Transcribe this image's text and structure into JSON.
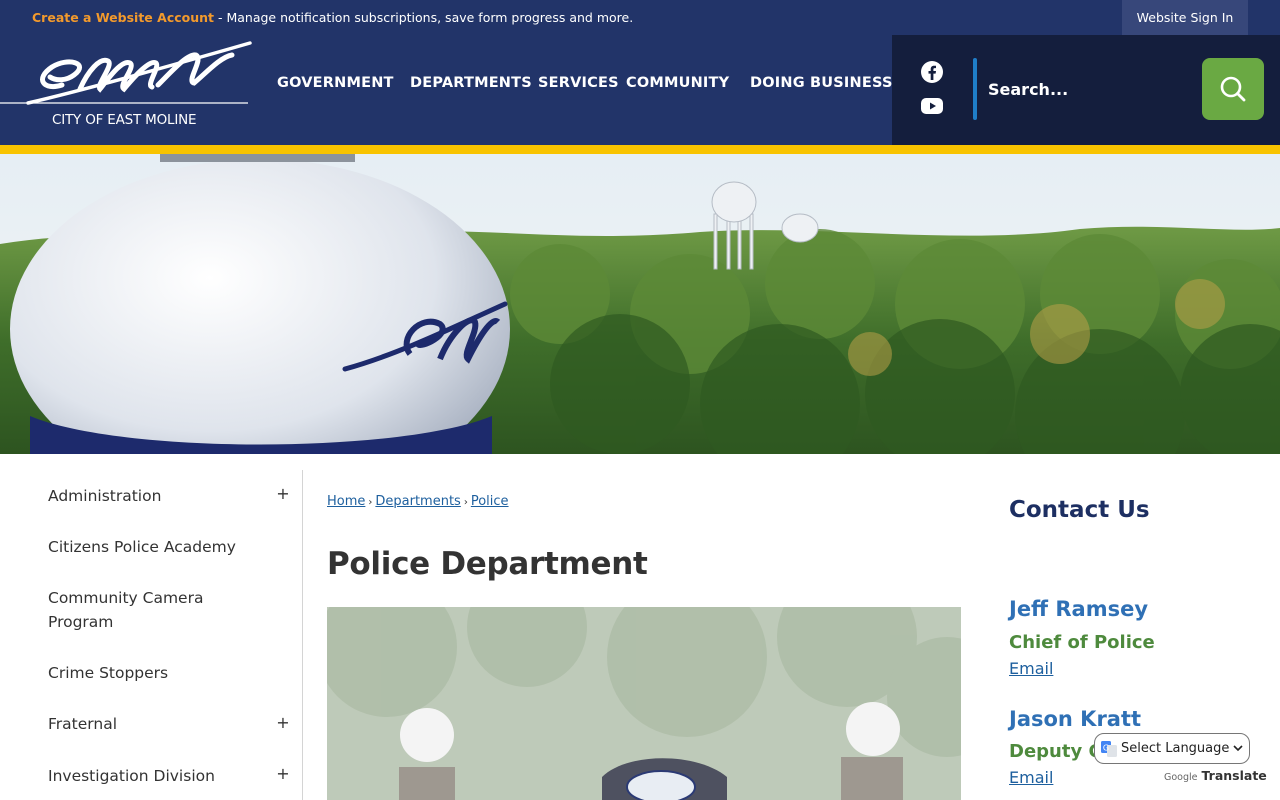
{
  "topbar": {
    "create_link": "Create a Website Account",
    "message": " - Manage notification subscriptions, save form progress and more.",
    "signin": "Website Sign In"
  },
  "logo": {
    "text": "CITY OF EAST MOLINE"
  },
  "nav": {
    "items": [
      {
        "label": "GOVERNMENT"
      },
      {
        "label": "DEPARTMENTS"
      },
      {
        "label": "SERVICES"
      },
      {
        "label": "COMMUNITY"
      },
      {
        "label": "DOING BUSINESS"
      }
    ]
  },
  "social": {
    "icons": [
      "facebook-icon",
      "youtube-icon"
    ]
  },
  "search": {
    "placeholder": "Search..."
  },
  "colors": {
    "brand_navy": "#223469",
    "dark_navy": "#141e3d",
    "accent_gold": "#f8c300",
    "accent_green": "#6aa943",
    "link_blue": "#1d5f9e",
    "orange_link": "#f39a2c"
  },
  "sidebar": {
    "items": [
      {
        "label": "Administration",
        "expandable": true
      },
      {
        "label": "Citizens Police Academy",
        "expandable": false
      },
      {
        "label": "Community Camera Program",
        "expandable": false
      },
      {
        "label": "Crime Stoppers",
        "expandable": false
      },
      {
        "label": "Fraternal",
        "expandable": true
      },
      {
        "label": "Investigation Division",
        "expandable": true
      }
    ],
    "toggle_symbol": "+"
  },
  "breadcrumb": {
    "items": [
      "Home",
      "Departments",
      "Police"
    ],
    "separator": "›"
  },
  "page": {
    "title": "Police Department"
  },
  "contact": {
    "title": "Contact Us",
    "people": [
      {
        "name": "Jeff Ramsey",
        "role": "Chief of Police",
        "email_label": "Email"
      },
      {
        "name": "Jason Kratt",
        "role": "Deputy Chief",
        "email_label": "Email"
      }
    ]
  },
  "translate": {
    "select_label": "Select Language",
    "powered_google": "Google",
    "powered_translate": "Translate"
  }
}
